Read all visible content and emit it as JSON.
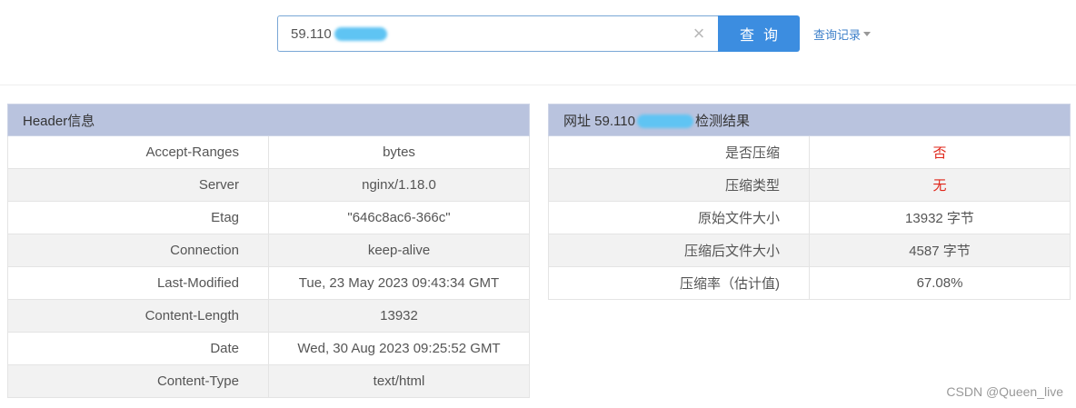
{
  "search": {
    "value": "59.110",
    "clear_symbol": "×",
    "button_label": "查询",
    "history_label": "查询记录"
  },
  "header_panel": {
    "title": "Header信息",
    "rows": [
      {
        "key": "Accept-Ranges",
        "value": "bytes"
      },
      {
        "key": "Server",
        "value": "nginx/1.18.0"
      },
      {
        "key": "Etag",
        "value": "\"646c8ac6-366c\""
      },
      {
        "key": "Connection",
        "value": "keep-alive"
      },
      {
        "key": "Last-Modified",
        "value": "Tue, 23 May 2023 09:43:34 GMT"
      },
      {
        "key": "Content-Length",
        "value": "13932"
      },
      {
        "key": "Date",
        "value": "Wed, 30 Aug 2023 09:25:52 GMT"
      },
      {
        "key": "Content-Type",
        "value": "text/html"
      }
    ]
  },
  "result_panel": {
    "title_prefix": "网址 59.110",
    "title_suffix": "检测结果",
    "rows": [
      {
        "key": "是否压缩",
        "value": "否"
      },
      {
        "key": "压缩类型",
        "value": "无"
      },
      {
        "key": "原始文件大小",
        "value": "13932 字节"
      },
      {
        "key": "压缩后文件大小",
        "value": "4587 字节"
      },
      {
        "key": "压缩率（估计值)",
        "value": "67.08%"
      }
    ]
  },
  "watermark": "CSDN @Queen_live",
  "colors": {
    "accent": "#3c8de0",
    "panel_header": "#b9c3de",
    "negative": "#e0261a"
  }
}
